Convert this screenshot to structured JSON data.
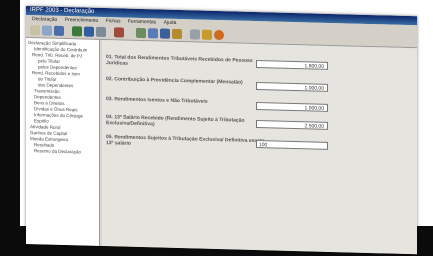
{
  "window": {
    "title": "IRPF 2003 - Declaração",
    "menu": [
      "Declaração",
      "Preenchimento",
      "Fichas",
      "Ferramentas",
      "Ajuda"
    ]
  },
  "sidebar": {
    "items": [
      "Declaração Simplificada",
      "Identificação do Contribuin",
      "Rend. Trib. Receb. de PJ",
      "pelo Titular",
      "pelos Dependentes",
      "Rend. Recebidos e Isen",
      "do Titular",
      "dos Dependentes",
      "Transmissão",
      "Dependentes",
      "Bens e Direitos",
      "Dívidas e Ônus Reais",
      "Informações do Cônjuge",
      "Espólio",
      "Atividade Rural",
      "Ganhos de Capital",
      "Moeda Estrangeira",
      "Resultado",
      "Resumo da Declaração"
    ]
  },
  "form": {
    "rows": [
      {
        "label": "01. Total dos Rendimentos Tributáveis Recebidos de Pessoas Jurídicas",
        "value": "1.800,00"
      },
      {
        "label": "02. Contribuição à Previdência Complementar (Mensalão)",
        "value": "1.000,00"
      },
      {
        "label": "03. Rendimentos Isentos e Não Tributáveis",
        "value": "1.000,00"
      },
      {
        "label": "04. 13º Salário Recebido (Rendimento Sujeito à Tributação Exclusiva/Definitiva)",
        "value": "2.500,00"
      },
      {
        "label": "05. Rendimentos Sujeitos à Tributação Exclusiva/ Definitiva exceto 13º salário",
        "value": "100"
      }
    ]
  }
}
